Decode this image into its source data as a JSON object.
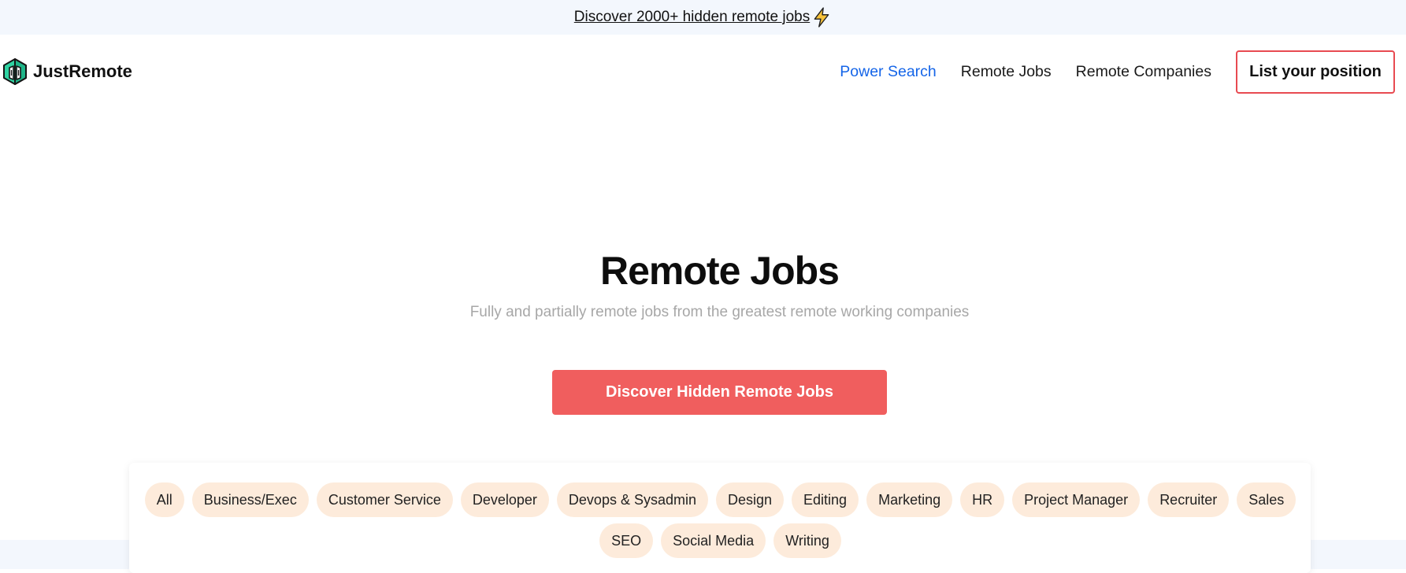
{
  "announcement": {
    "text": "Discover 2000+ hidden remote jobs",
    "icon": "lightning-bolt-icon"
  },
  "header": {
    "logo_text": "JustRemote",
    "logo_icon": "justremote-logo-icon",
    "nav": [
      {
        "label": "Power Search",
        "active": true
      },
      {
        "label": "Remote Jobs",
        "active": false
      },
      {
        "label": "Remote Companies",
        "active": false
      }
    ],
    "cta_label": "List your position"
  },
  "hero": {
    "title": "Remote Jobs",
    "subtitle": "Fully and partially remote jobs from the greatest remote working companies",
    "button_label": "Discover Hidden Remote Jobs"
  },
  "filters": {
    "categories": [
      "All",
      "Business/Exec",
      "Customer Service",
      "Developer",
      "Devops & Sysadmin",
      "Design",
      "Editing",
      "Marketing",
      "HR",
      "Project Manager",
      "Recruiter",
      "Sales",
      "SEO",
      "Social Media",
      "Writing"
    ]
  },
  "colors": {
    "accent_red": "#f05e5e",
    "active_blue": "#1565e8",
    "chip_bg": "#fdebdb",
    "band_bg": "#f3f7fd"
  }
}
